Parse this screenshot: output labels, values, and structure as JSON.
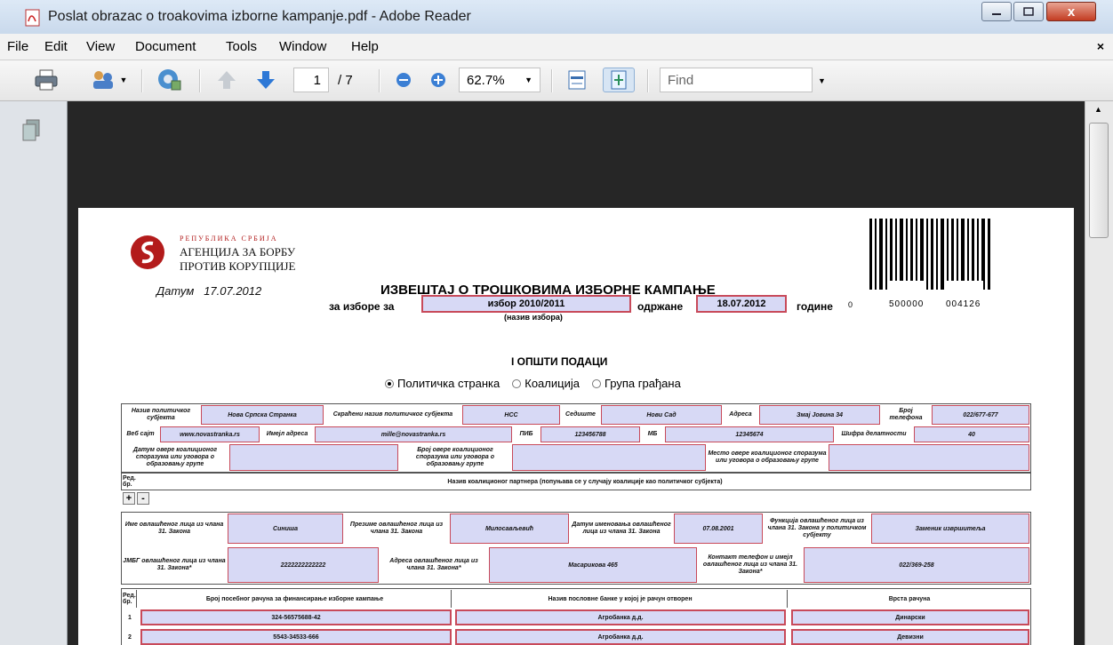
{
  "window": {
    "title": "Poslat obrazac o troakovima izborne kampanje.pdf - Adobe Reader",
    "close_glyph": "x"
  },
  "menu": {
    "items": [
      "File",
      "Edit",
      "View",
      "Document",
      "Tools",
      "Window",
      "Help"
    ],
    "close_glyph": "×"
  },
  "toolbar": {
    "page_current": "1",
    "page_total": "/ 7",
    "zoom": "62.7%",
    "find_placeholder": "Find"
  },
  "document": {
    "agency": {
      "line1": "РЕПУБЛИКА СРБИЈА",
      "line2": "АГЕНЦИЈА ЗА БОРБУ",
      "line3": "ПРОТИВ КОРУПЦИЈЕ"
    },
    "date_label": "Датум",
    "date_value": "17.07.2012",
    "heading": "ИЗВЕШТАЈ О ТРОШКОВИМА ИЗБОРНЕ КАМПАЊЕ",
    "for_elections_label": "за изборе за",
    "election_name": "избор 2010/2011",
    "election_name_caption": "(назив избора)",
    "held_label": "одржане",
    "held_date": "18.07.2012",
    "year_label": "године",
    "barcode_prefix": "0",
    "barcode_left": "500000",
    "barcode_right": "004126",
    "section_title": "I ОПШТИ ПОДАЦИ",
    "subject_types": [
      {
        "label": "Политичка странка",
        "selected": true
      },
      {
        "label": "Коалиција",
        "selected": false
      },
      {
        "label": "Група грађана",
        "selected": false
      }
    ],
    "row1": {
      "name_label": "Назив политичког субјекта",
      "name_value": "Нова Српска Странка",
      "short_label": "Скраћени назив политичког субјекта",
      "short_value": "НСС",
      "seat_label": "Седиште",
      "seat_value": "Нови Сад",
      "address_label": "Адреса",
      "address_value": "Змај Јовина 34",
      "phone_label": "Број телефона",
      "phone_value": "022/677-677"
    },
    "row2": {
      "web_label": "Веб сајт",
      "web_value": "www.novastranka.rs",
      "email_label": "Имејл адреса",
      "email_value": "mille@novastranka.rs",
      "pib_label": "ПИБ",
      "pib_value": "123456788",
      "mb_label": "МБ",
      "mb_value": "12345674",
      "activity_label": "Шифра делатности",
      "activity_value": "40"
    },
    "row3": {
      "coalition_date_label": "Датум овере коалиционог споразума или уговора о образовању групе",
      "coalition_no_label": "Број овере коалиционог споразума или уговора о образовању групе",
      "coalition_place_label": "Место овере коалиционог споразума или уговора о образовању групе"
    },
    "partners": {
      "no_label": "Ред. бр.",
      "title": "Назив коалиционог партнера (попуњава се у случају коалиције као политичког субјекта)"
    },
    "person": {
      "first_name_label": "Име овлашћеног лица из члана 31. Закона",
      "first_name_value": "Синиша",
      "last_name_label": "Презиме овлашћеног лица из члана 31. Закона",
      "last_name_value": "Милосављевић",
      "appoint_date_label": "Датум именовања овлашћеног лица из члана 31. Закона",
      "appoint_date_value": "07.08.2001",
      "function_label": "Функција овлашћеног лица из члана 31. Закона у политичком субјекту",
      "function_value": "Заменик изврши­теља",
      "jmbg_label": "ЈМБГ овлашћеног лица из члана 31. Закона*",
      "jmbg_value": "2222222222222",
      "address_label": "Адреса овлашћеног лица из члана 31. Закона*",
      "address_value": "Масарикова 465",
      "contact_label": "Контакт телефон и имејл овлашћеног лица из члана 31. Закона*",
      "contact_value": "022/369-258"
    },
    "accounts": {
      "no_label": "Ред. бр.",
      "col1": "Број посебног рачуна за финансирање изборне кампање",
      "col2": "Назив пословне банке у којој је рачун отворен",
      "col3": "Врста рачуна",
      "rows": [
        {
          "no": "1",
          "account": "324-56575688-42",
          "bank": "Агробанка д.д.",
          "type": "Динарски"
        },
        {
          "no": "2",
          "account": "5543-34533-666",
          "bank": "Агробанка д.д.",
          "type": "Девизни"
        }
      ]
    },
    "plus": "+",
    "minus": "-"
  }
}
